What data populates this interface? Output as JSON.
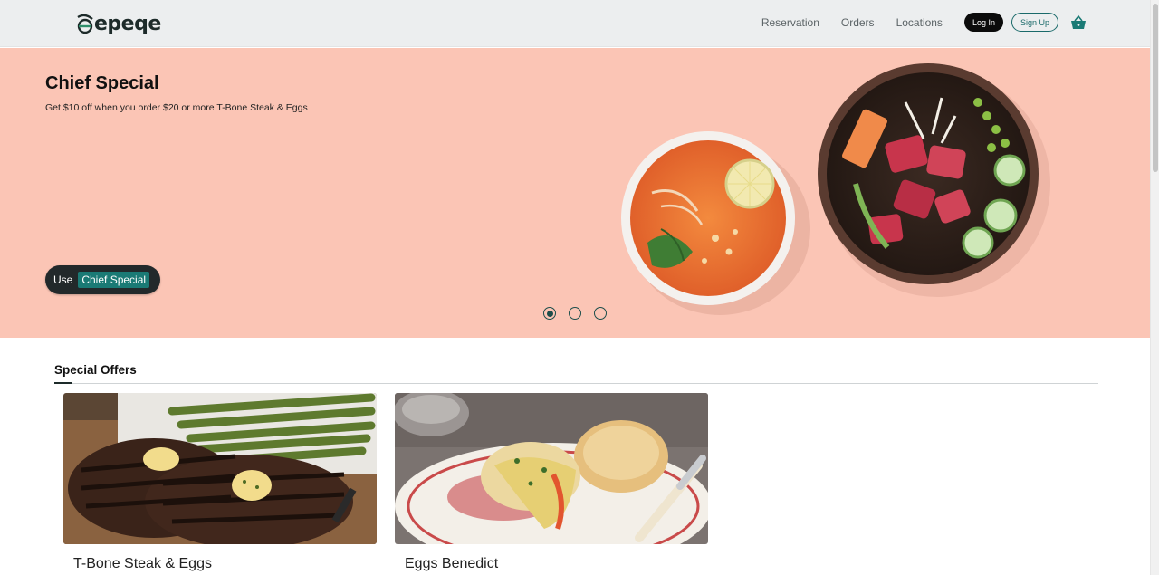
{
  "header": {
    "logo_text": "epeqe",
    "nav": {
      "reservation": "Reservation",
      "orders": "Orders",
      "locations": "Locations"
    },
    "login_label": "Log In",
    "signup_label": "Sign Up",
    "cart_icon": "basket-icon",
    "accent": "#1a6a6a"
  },
  "hero": {
    "title": "Chief Special",
    "subtitle": "Get $10 off when you order $20 or more T-Bone Steak & Eggs",
    "promo_use": "Use",
    "promo_code": "Chief Special",
    "background": "#fbc5b5",
    "carousel": {
      "count": 3,
      "active_index": 0
    }
  },
  "special_offers": {
    "title": "Special Offers",
    "items": [
      {
        "title": "T-Bone Steak & Eggs"
      },
      {
        "title": "Eggs Benedict"
      }
    ]
  }
}
